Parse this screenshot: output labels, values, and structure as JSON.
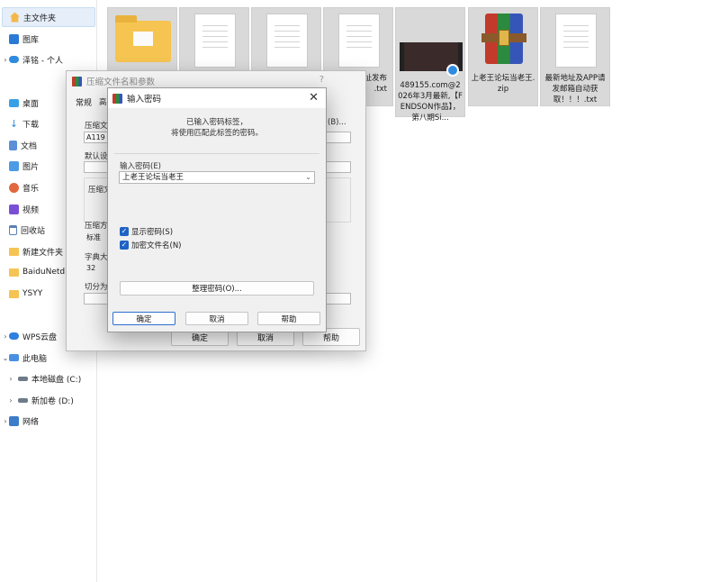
{
  "sidebar": {
    "items": [
      {
        "label": "主文件夹",
        "icon": "home-icon"
      },
      {
        "label": "图库",
        "icon": "gallery-icon"
      },
      {
        "label": "泽铭 - 个人",
        "icon": "onedrive-cloud-icon"
      },
      {
        "label": "桌面",
        "icon": "desktop-icon"
      },
      {
        "label": "下载",
        "icon": "download-icon"
      },
      {
        "label": "文档",
        "icon": "documents-icon"
      },
      {
        "label": "图片",
        "icon": "pictures-icon"
      },
      {
        "label": "音乐",
        "icon": "music-icon"
      },
      {
        "label": "视频",
        "icon": "videos-icon"
      },
      {
        "label": "回收站",
        "icon": "recycle-bin-icon"
      },
      {
        "label": "新建文件夹",
        "icon": "folder-icon"
      },
      {
        "label": "BaiduNetdisk",
        "icon": "folder-icon"
      },
      {
        "label": "YSYY",
        "icon": "folder-icon"
      },
      {
        "label": "WPS云盘",
        "icon": "wps-cloud-icon"
      },
      {
        "label": "此电脑",
        "icon": "this-pc-icon"
      },
      {
        "label": "本地磁盘 (C:)",
        "icon": "drive-icon"
      },
      {
        "label": "新加卷 (D:)",
        "icon": "drive-icon"
      },
      {
        "label": "网络",
        "icon": "network-icon"
      }
    ]
  },
  "files": [
    {
      "name": "",
      "kind": "folder"
    },
    {
      "name": "",
      "kind": "document"
    },
    {
      "name": "",
      "kind": "document"
    },
    {
      "name": "址发布\n.txt",
      "kind": "document"
    },
    {
      "name": "489155.com@2026年3月最新,【FENDSON作品】，第八期Si...",
      "kind": "video"
    },
    {
      "name": "上老王论坛当老王.zip",
      "kind": "archive"
    },
    {
      "name": "最新地址及APP请发邮箱自动获取！！！.txt",
      "kind": "document"
    }
  ],
  "archive_dialog": {
    "title": "压缩文件名和参数",
    "help": "?",
    "tab_general": "常规",
    "tab_second": "高",
    "label_archive_name": "压缩文件",
    "archive_name_value": "A119",
    "browse_label": "(B)...",
    "label_default": "默认设置",
    "label_archive_format": "压缩文",
    "label_method": "压缩方式",
    "method_value": "标准",
    "label_dict": "字典大小",
    "dict_value": "32",
    "label_split": "切分为分",
    "ok": "确定",
    "cancel": "取消",
    "help_button": "帮助"
  },
  "password_dialog": {
    "title": "输入密码",
    "close": "✕",
    "message_line1": "已输入密码标签，",
    "message_line2": "将使用匹配此标签的密码。",
    "input_label": "输入密码(E)",
    "password_value": "上老王论坛当老王",
    "show_password": "显示密码(S)",
    "show_password_checked": true,
    "encrypt_filenames": "加密文件名(N)",
    "encrypt_filenames_checked": true,
    "manage_passwords": "整理密码(O)...",
    "ok": "确定",
    "cancel": "取消",
    "help": "帮助"
  }
}
